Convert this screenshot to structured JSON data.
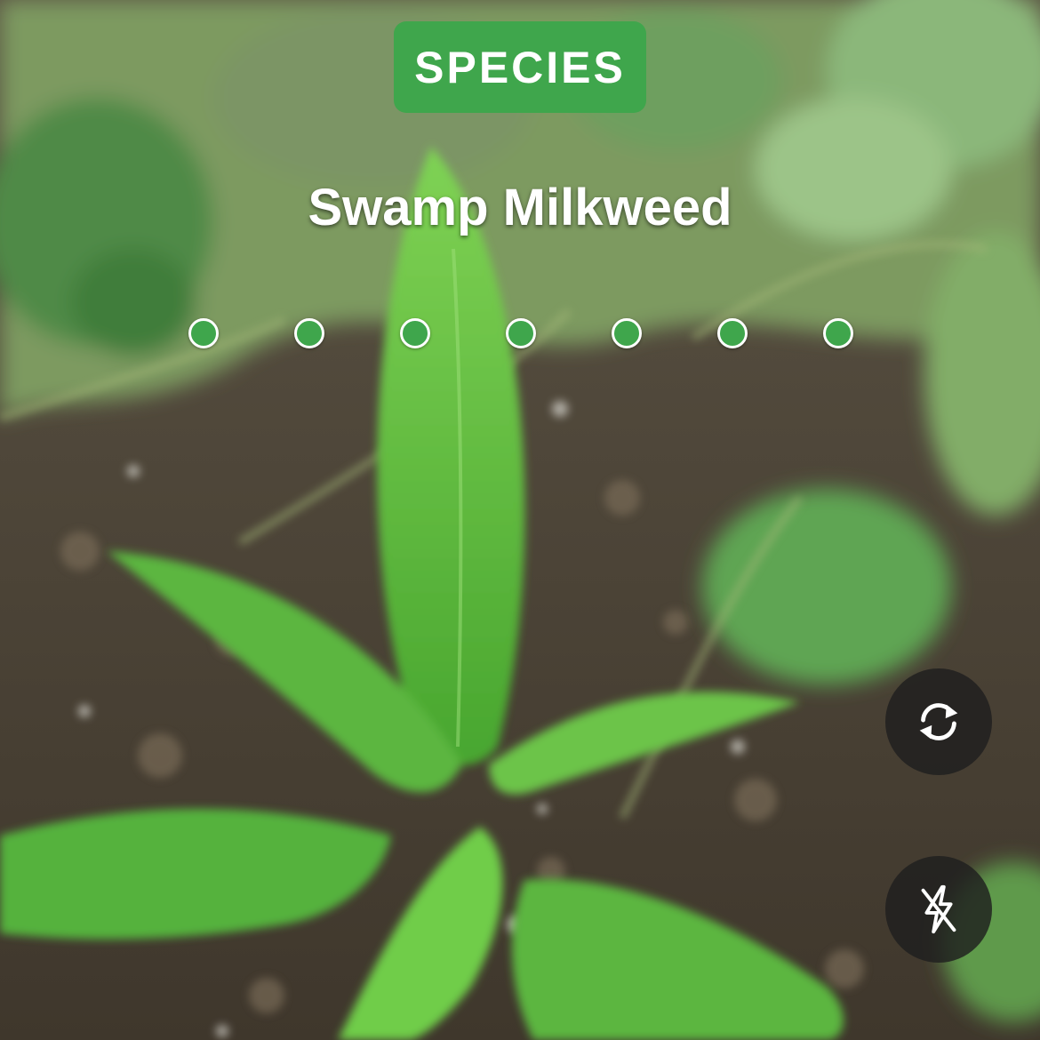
{
  "viewfinder": {
    "rank_label": "SPECIES",
    "species_name": "Swamp Milkweed",
    "rank_levels_filled": 7,
    "rank_levels_total": 7,
    "accent_color": "#3fa64c"
  },
  "controls": {
    "flip_camera_icon": "rotate-camera-icon",
    "flash_icon": "flash-off-icon"
  }
}
